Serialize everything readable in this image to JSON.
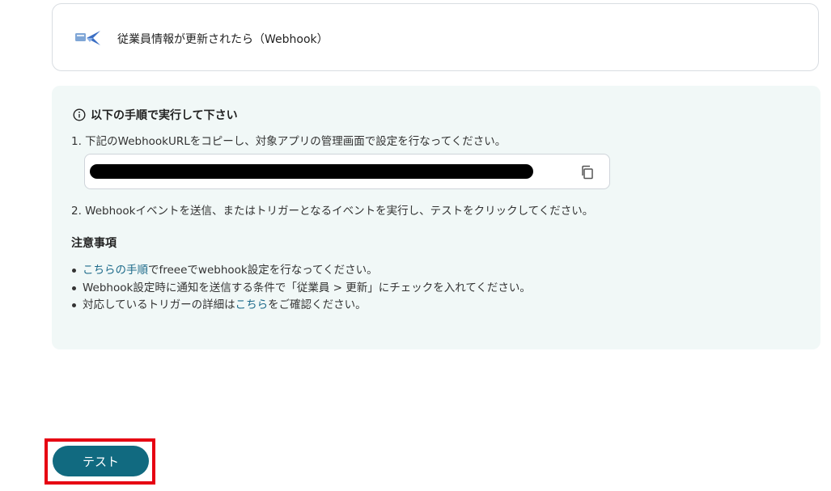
{
  "trigger": {
    "title": "従業員情報が更新されたら（Webhook）",
    "icon": "webhook-bird-icon"
  },
  "instructions": {
    "heading": "以下の手順で実行して下さい",
    "step1": "1. 下記のWebhookURLをコピーし、対象アプリの管理画面で設定を行なってください。",
    "url_value": "",
    "step2": "2. Webhookイベントを送信、またはトリガーとなるイベントを実行し、テストをクリックしてください。",
    "notes_heading": "注意事項",
    "notes": [
      {
        "link": "こちらの手順",
        "text": "でfreeeでwebhook設定を行なってください。"
      },
      {
        "text": "Webhook設定時に通知を送信する条件で「従業員 > 更新」にチェックを入れてください。"
      },
      {
        "before": "対応しているトリガーの詳細は",
        "link": "こちら",
        "after": "をご確認ください。"
      }
    ]
  },
  "actions": {
    "test_label": "テスト"
  },
  "colors": {
    "accent": "#116a80",
    "link": "#1d6a8a",
    "panel_bg": "#f1f8f7",
    "highlight": "#e60012"
  }
}
